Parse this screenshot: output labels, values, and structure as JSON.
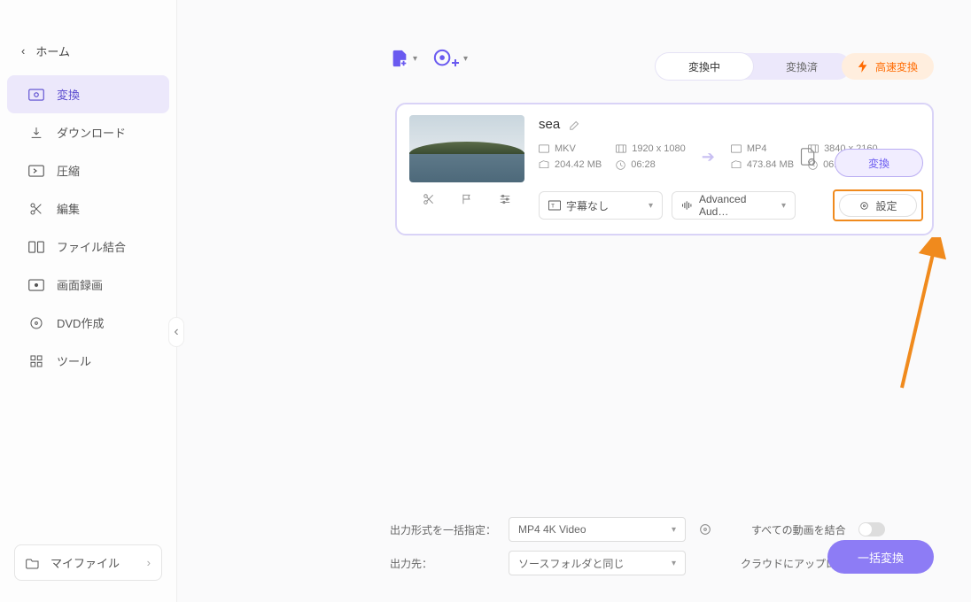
{
  "sidebar": {
    "home": "ホーム",
    "items": [
      {
        "label": "変換"
      },
      {
        "label": "ダウンロード"
      },
      {
        "label": "圧縮"
      },
      {
        "label": "編集"
      },
      {
        "label": "ファイル結合"
      },
      {
        "label": "画面録画"
      },
      {
        "label": "DVD作成"
      },
      {
        "label": "ツール"
      }
    ],
    "myfile": "マイファイル"
  },
  "tabs": {
    "converting": "変換中",
    "converted": "変換済"
  },
  "fast_convert": "高速変換",
  "card": {
    "filename": "sea",
    "src": {
      "format": "MKV",
      "resolution": "1920 x 1080",
      "size": "204.42 MB",
      "duration": "06:28"
    },
    "dst": {
      "format": "MP4",
      "resolution": "3840 x 2160",
      "size": "473.84 MB",
      "duration": "06:28"
    },
    "convert_label": "変換",
    "subtitle": "字幕なし",
    "audio": "Advanced Aud…",
    "settings_label": "設定"
  },
  "bottom": {
    "format_label": "出力形式を一括指定：",
    "format_value": "MP4 4K Video",
    "merge_label": "すべての動画を結合",
    "dest_label": "出力先：",
    "dest_value": "ソースフォルダと同じ",
    "cloud_label": "クラウドにアップロード",
    "batch_label": "一括変換"
  }
}
